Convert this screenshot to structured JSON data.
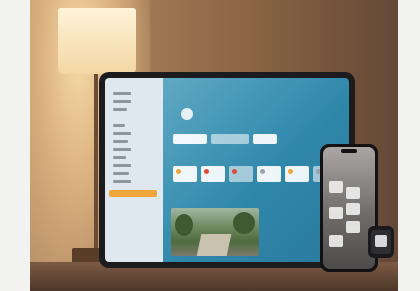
{
  "scene": {
    "colors": {
      "wall_glow": "#f6d9a6",
      "screen_accent": "#2f87aa",
      "selected_item": "#f0a63a"
    }
  },
  "laptop": {
    "sidebar": {
      "items": [
        {
          "label": ""
        },
        {
          "label": ""
        },
        {
          "label": ""
        },
        {
          "label": ""
        },
        {
          "label": ""
        },
        {
          "label": ""
        },
        {
          "label": ""
        },
        {
          "label": ""
        },
        {
          "label": ""
        },
        {
          "label": ""
        },
        {
          "label": ""
        },
        {
          "label": "",
          "selected": true
        }
      ]
    },
    "main": {
      "title": "",
      "status": "",
      "camera_label": "",
      "tile_icons": [
        "light-icon",
        "power-icon",
        "power-icon",
        "light-icon",
        "thermostat-icon",
        "power-icon",
        "light-icon"
      ]
    }
  },
  "phone": {
    "tile_count": 6
  },
  "watch": {
    "tile_count": 1
  }
}
